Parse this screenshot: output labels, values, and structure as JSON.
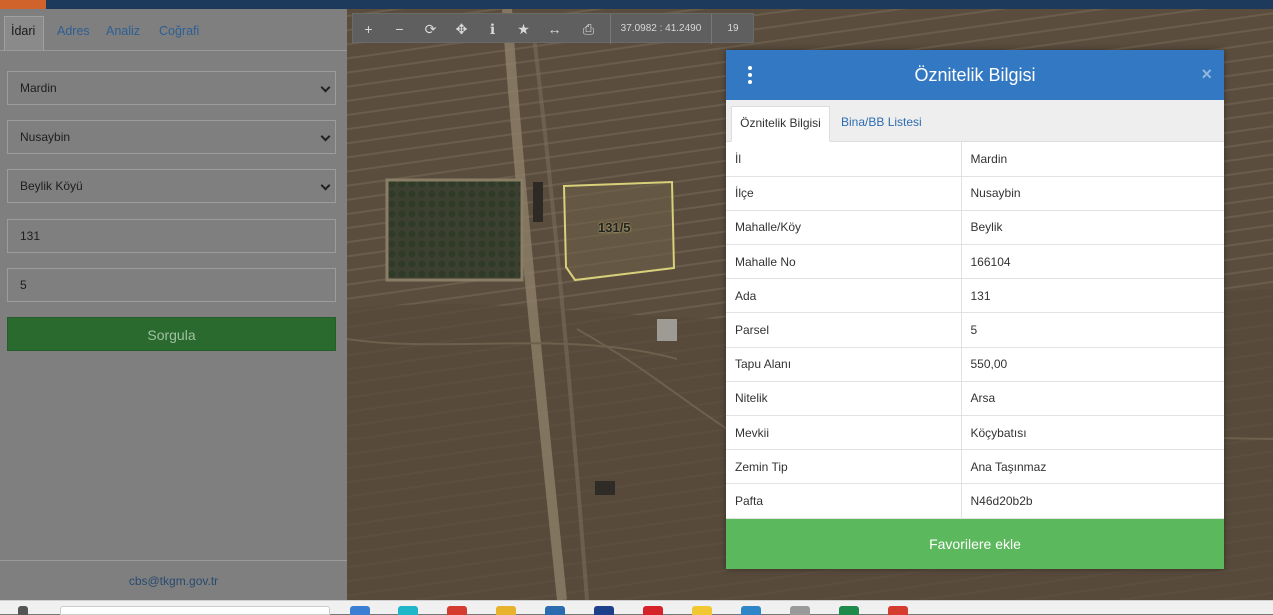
{
  "left_panel": {
    "tabs": [
      {
        "label": "İdari"
      },
      {
        "label": "Adres"
      },
      {
        "label": "Analiz"
      },
      {
        "label": "Coğrafi"
      }
    ],
    "il": "Mardin",
    "ilce": "Nusaybin",
    "mahalle": "Beylik Köyü",
    "ada": "131",
    "parsel": "5",
    "query_button": "Sorgula",
    "footer_email": "cbs@tkgm.gov.tr"
  },
  "map": {
    "toolbar": {
      "coordinates": "37.0982 : 41.2490",
      "zoom": "19",
      "icons": [
        "zoom-in-icon",
        "zoom-out-icon",
        "refresh-icon",
        "locate-icon",
        "info-icon",
        "favorite-icon",
        "measure-icon",
        "print-icon"
      ]
    },
    "parcel_label": "131/5"
  },
  "dialog": {
    "title": "Öznitelik Bilgisi",
    "close": "×",
    "tabs": [
      {
        "label": "Öznitelik Bilgisi"
      },
      {
        "label": "Bina/BB Listesi"
      }
    ],
    "rows": [
      {
        "key": "İl",
        "value": "Mardin"
      },
      {
        "key": "İlçe",
        "value": "Nusaybin"
      },
      {
        "key": "Mahalle/Köy",
        "value": "Beylik"
      },
      {
        "key": "Mahalle No",
        "value": "166104"
      },
      {
        "key": "Ada",
        "value": "131"
      },
      {
        "key": "Parsel",
        "value": "5"
      },
      {
        "key": "Tapu Alanı",
        "value": "550,00"
      },
      {
        "key": "Nitelik",
        "value": "Arsa"
      },
      {
        "key": "Mevkii",
        "value": "Köçybatısı"
      },
      {
        "key": "Zemin Tip",
        "value": "Ana Taşınmaz"
      },
      {
        "key": "Pafta",
        "value": "N46d20b2b"
      }
    ],
    "favorite_button": "Favorilere ekle"
  },
  "colors": {
    "header_blue": "#3278c2",
    "favorite_green": "#5cb85c",
    "query_green": "#2a6a2e",
    "parcel_outline": "#d8d07a"
  }
}
